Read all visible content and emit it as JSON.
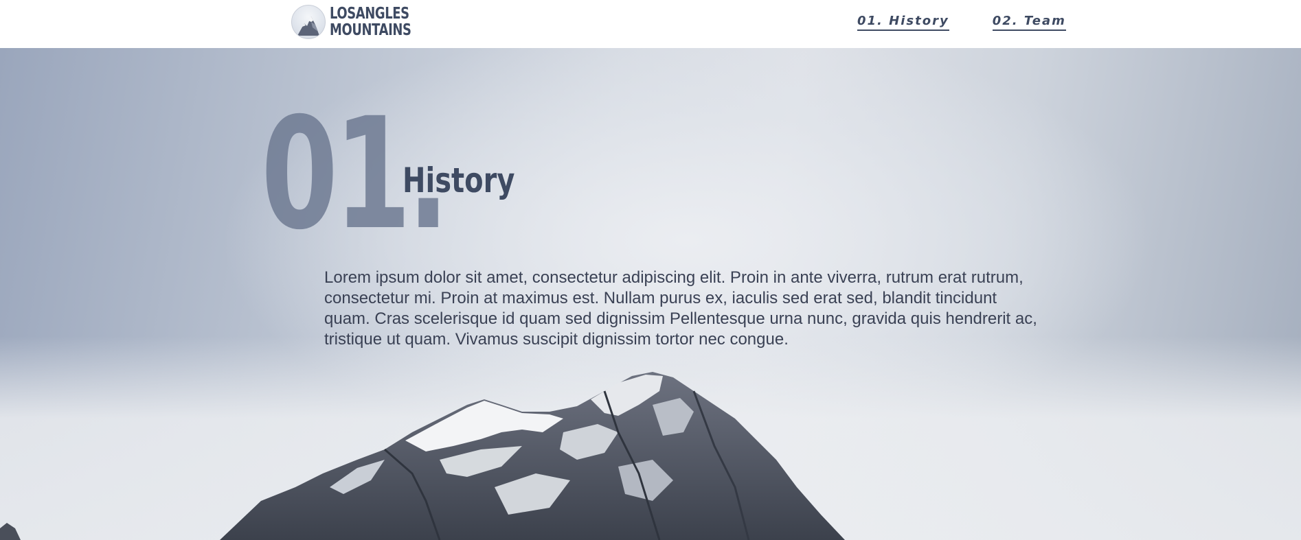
{
  "header": {
    "logo": {
      "line1": "LOSANGLES",
      "line2": "MOUNTAINS",
      "icon": "mountain-logo-icon"
    },
    "nav": [
      {
        "label": "01. History"
      },
      {
        "label": "02. Team"
      }
    ]
  },
  "hero": {
    "number": "01.",
    "title": "History",
    "body": "Lorem ipsum dolor sit amet, consectetur adipiscing elit. Proin in ante viverra, rutrum erat rutrum, consectetur mi. Proin at maximus est. Nullam purus ex, iaculis sed erat sed, blandit tincidunt quam. Cras scelerisque id quam sed dignissim Pellentesque urna nunc, gravida quis hendrerit ac, tristique ut quam. Vivamus suscipit dignissim tortor nec congue."
  },
  "colors": {
    "text_dark": "#3e4a62",
    "number_muted": "#6f7b93",
    "sky_light": "#dfe2e8"
  }
}
